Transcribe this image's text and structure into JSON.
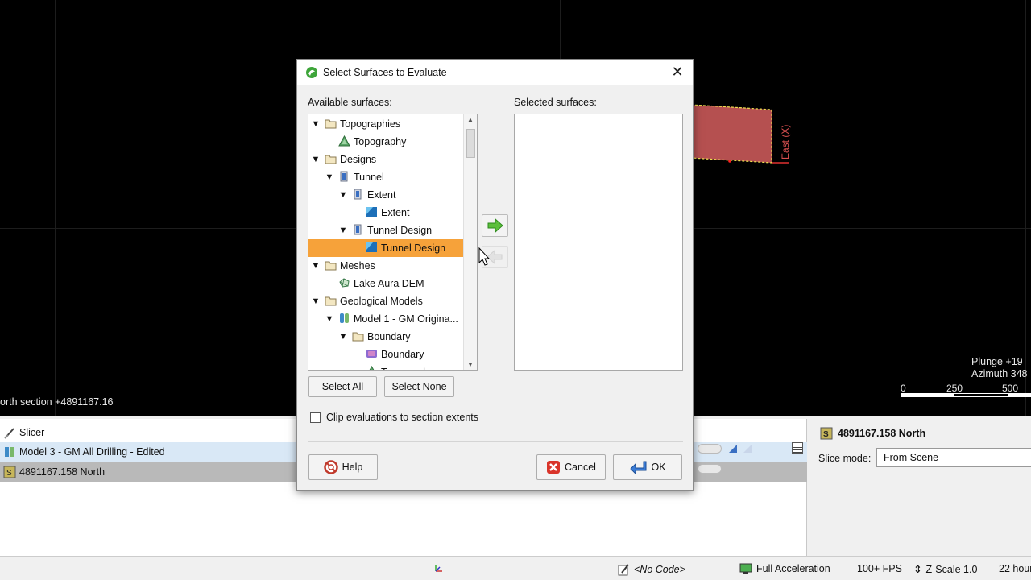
{
  "scene": {
    "section_readout": "orth section +4891167.16",
    "east_label": "East (X)",
    "plunge": "Plunge +19",
    "azimuth": "Azimuth 348",
    "scale_ticks": [
      "0",
      "250",
      "500"
    ],
    "section_color": "#b55050"
  },
  "dialog": {
    "title": "Select Surfaces to Evaluate",
    "available_label": "Available surfaces:",
    "selected_label": "Selected surfaces:",
    "tree": [
      {
        "label": "Topographies",
        "icon": "folder-icon",
        "expanded": true
      },
      {
        "label": "Topography",
        "icon": "topography-icon"
      },
      {
        "label": "Designs",
        "icon": "folder-icon",
        "expanded": true
      },
      {
        "label": "Tunnel",
        "icon": "design-icon",
        "expanded": true
      },
      {
        "label": "Extent",
        "icon": "design-icon",
        "expanded": true
      },
      {
        "label": "Extent",
        "icon": "surface-icon"
      },
      {
        "label": "Tunnel Design",
        "icon": "design-icon",
        "expanded": true
      },
      {
        "label": "Tunnel Design",
        "icon": "surface-icon",
        "selected": true
      },
      {
        "label": "Meshes",
        "icon": "folder-icon",
        "expanded": true
      },
      {
        "label": "Lake Aura DEM",
        "icon": "mesh-icon"
      },
      {
        "label": "Geological Models",
        "icon": "folder-icon",
        "expanded": true
      },
      {
        "label": "Model 1 - GM Origina...",
        "icon": "geomodel-icon",
        "expanded": true
      },
      {
        "label": "Boundary",
        "icon": "folder-icon",
        "expanded": true
      },
      {
        "label": "Boundary",
        "icon": "boundary-icon"
      },
      {
        "label": "Topography",
        "icon": "topography-icon"
      }
    ],
    "select_all": "Select All",
    "select_none": "Select None",
    "clip_label": "Clip evaluations to section extents",
    "clip_checked": false,
    "help": "Help",
    "cancel": "Cancel",
    "ok": "OK"
  },
  "lower": {
    "rows": [
      {
        "label": "Slicer",
        "icon": "slicer-icon"
      },
      {
        "label": "Model 3 - GM All Drilling - Edited",
        "icon": "geomodel-icon"
      },
      {
        "label": "4891167.158 North",
        "icon": "section-icon"
      }
    ],
    "props_title": "4891167.158 North",
    "slice_mode_label": "Slice mode:",
    "slice_mode_value": "From Scene"
  },
  "status": {
    "no_code": "<No Code>",
    "acceleration": "Full Acceleration",
    "fps": "100+ FPS",
    "zscale": "Z-Scale 1.0",
    "hours": "22 hour"
  },
  "colors": {
    "selection": "#f6a23a",
    "accent_green": "#3ea53a",
    "cancel_red": "#d9342a"
  }
}
